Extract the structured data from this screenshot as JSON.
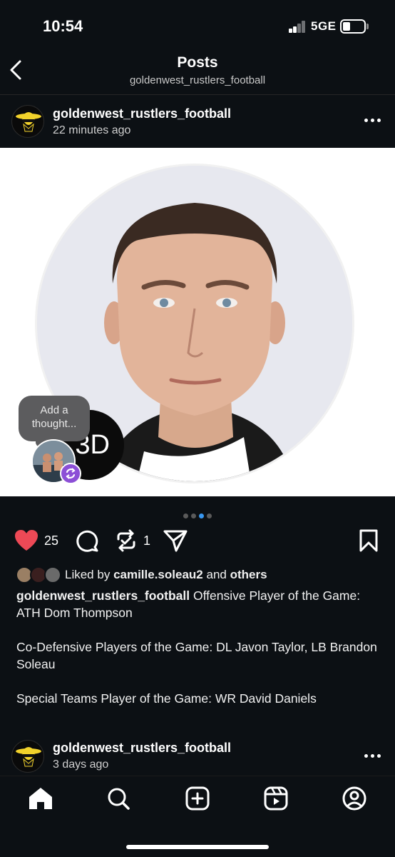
{
  "status_bar": {
    "time": "10:54",
    "network": "5GE"
  },
  "header": {
    "title": "Posts",
    "subtitle": "goldenwest_rustlers_football"
  },
  "post": {
    "username": "goldenwest_rustlers_football",
    "time_ago": "22 minutes ago",
    "image": {
      "badge_text": "3D",
      "thought_bubble": "Add a thought..."
    },
    "carousel": {
      "count": 4,
      "active_index": 2
    },
    "likes_count": "25",
    "reposts_count": "1",
    "liked_by": {
      "prefix": "Liked by",
      "user": "camille.soleau2",
      "joiner": "and",
      "suffix": "others"
    },
    "caption": {
      "author": "goldenwest_rustlers_football",
      "line1": "Offensive Player of the Game: ATH Dom Thompson",
      "line2": "Co-Defensive Players of the Game: DL Javon Taylor, LB Brandon Soleau",
      "line3": "Special Teams Player of the Game: WR David Daniels"
    },
    "colors": {
      "like": "#ed4956",
      "accent": "#3897f0",
      "repost_badge": "#8c4fd6"
    }
  },
  "next_post": {
    "username": "goldenwest_rustlers_football",
    "time_ago": "3 days ago"
  },
  "tab_bar": {
    "tabs": [
      "home-icon",
      "search-icon",
      "create-icon",
      "reels-icon",
      "profile-icon"
    ]
  }
}
